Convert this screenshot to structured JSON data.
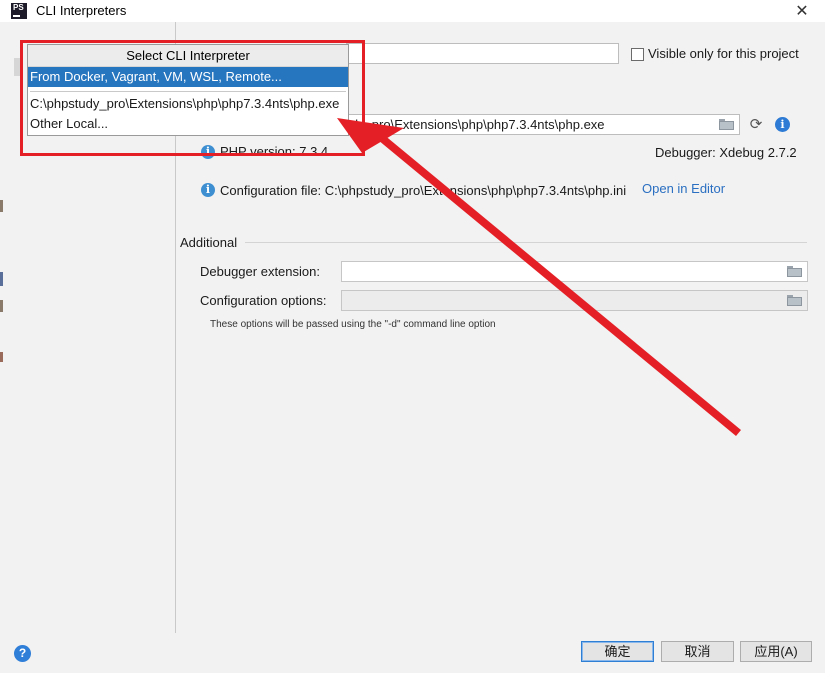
{
  "window": {
    "title": "CLI Interpreters",
    "logo_text": "PS"
  },
  "popup": {
    "header": "Select CLI Interpreter",
    "items": [
      {
        "label": "From Docker, Vagrant, VM, WSL, Remote...",
        "selected": true
      },
      {
        "label": "C:\\phpstudy_pro\\Extensions\\php\\php7.3.4nts\\php.exe",
        "selected": false
      },
      {
        "label": "Other Local...",
        "selected": false
      }
    ]
  },
  "form": {
    "name_value": "",
    "visible_only_label": "Visible only for this project",
    "visible_only_checked": false,
    "php_path_visible": "tudy_pro\\Extensions\\php\\php7.3.4nts\\php.exe",
    "php_version": "PHP version: 7.3.4",
    "debugger": "Debugger: Xdebug 2.7.2",
    "config_file": "Configuration file: C:\\phpstudy_pro\\Extensions\\php\\php7.3.4nts\\php.ini",
    "open_in_editor": "Open in Editor"
  },
  "additional": {
    "title": "Additional",
    "debugger_extension_label": "Debugger extension:",
    "debugger_extension_value": "",
    "configuration_options_label": "Configuration options:",
    "configuration_options_value": "",
    "hint": "These options will be passed using the \"-d\" command line option"
  },
  "buttons": {
    "ok": "确定",
    "cancel": "取消",
    "apply": "应用(A)"
  },
  "help": {
    "glyph": "?"
  },
  "colors": {
    "accent": "#2675bf",
    "annotation": "#e42026",
    "link": "#2a6fc1",
    "info": "#3d8fd1"
  },
  "icons": [
    "app-logo-icon",
    "close-icon",
    "folder-icon",
    "refresh-icon",
    "info-icon",
    "help-icon"
  ]
}
